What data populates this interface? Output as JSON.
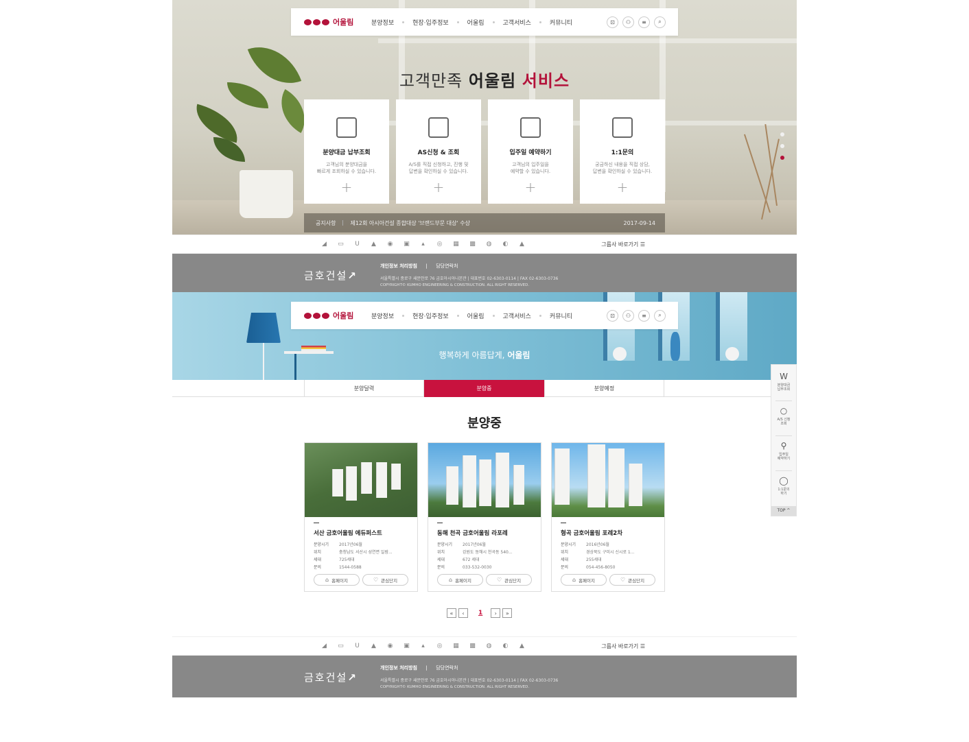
{
  "nav": {
    "logo_text": "어울림",
    "menu": [
      "분양정보",
      "현장·입주정보",
      "어울림",
      "고객서비스",
      "커뮤니티"
    ],
    "utils": [
      "lock-icon",
      "user-icon",
      "menu-icon",
      "search-icon"
    ]
  },
  "hero1": {
    "title_part1": "고객만족",
    "title_part2": "어울림",
    "title_part3": "서비스",
    "cards": [
      {
        "title": "분양대금 납부조회",
        "desc1": "고객님의 분양대금을",
        "desc2": "빠르게 조회하실 수 있습니다."
      },
      {
        "title": "AS신청 & 조회",
        "desc1": "A/S를 직접 신청하고, 진행 및",
        "desc2": "답변을 확인하실 수 있습니다."
      },
      {
        "title": "입주일 예약하기",
        "desc1": "고객님의 입주일을",
        "desc2": "예약할 수 있습니다."
      },
      {
        "title": "1:1문의",
        "desc1": "궁금하신 내용을 직접 상담,",
        "desc2": "답변을 확인하실 수 있습니다."
      }
    ],
    "plus": "+",
    "notice_label": "공지사항",
    "notice_text": "제12회 아시아건설 종합대상 '브랜드부문 대상' 수상",
    "notice_date": "2017-09-14"
  },
  "iconbar": {
    "icons": [
      "◢",
      "▭",
      "U",
      "▲",
      "◉",
      "▣",
      "▴",
      "◎",
      "▦",
      "▩",
      "◍",
      "◐",
      "▲"
    ],
    "shortcut": "그룹사 바로가기 ☰"
  },
  "footer": {
    "logo": "금호건설",
    "link1": "개인정보 처리방침",
    "sep": "|",
    "link2": "담당연락처",
    "address": "서울특별시 종로구 새문안로 76 금호아시아나본관  |  대표번호 02-6303-0114  |  FAX 02-6303-0736",
    "copyright": "COPYRIGHT© KUMHO ENGINEERING & CONSTRUCTION. ALL RIGHT RESERVED."
  },
  "hero2": {
    "title_part1": "행복하게 아름답게,",
    "title_part2": "어울림"
  },
  "tabs": [
    {
      "label": "분양달력",
      "active": false
    },
    {
      "label": "분양중",
      "active": true
    },
    {
      "label": "분양예정",
      "active": false
    }
  ],
  "section_title": "분양중",
  "projects": [
    {
      "name": "서산 금호어울림 에듀퍼스트",
      "rows": [
        {
          "k": "분양시기",
          "v": "2017년06월"
        },
        {
          "k": "위치",
          "v": "충청남도 서산시 성연면 일람..."
        },
        {
          "k": "세대",
          "v": "725세대"
        },
        {
          "k": "문의",
          "v": "1544-0588"
        }
      ],
      "btn_home": "홈페이지",
      "btn_fav": "관심단지"
    },
    {
      "name": "동해 천곡 금호어울림 라포레",
      "rows": [
        {
          "k": "분양시기",
          "v": "2017년06월"
        },
        {
          "k": "위치",
          "v": "강원도 동해시 천곡동 540..."
        },
        {
          "k": "세대",
          "v": "672 세대"
        },
        {
          "k": "문의",
          "v": "033-532-0030"
        }
      ],
      "btn_home": "홈페이지",
      "btn_fav": "관심단지"
    },
    {
      "name": "형곡 금호어울림 포레2차",
      "rows": [
        {
          "k": "분양시기",
          "v": "2016년06월"
        },
        {
          "k": "위치",
          "v": "경상북도 구미시 신시로 1..."
        },
        {
          "k": "세대",
          "v": "255세대"
        },
        {
          "k": "문의",
          "v": "054-456-8050"
        }
      ],
      "btn_home": "홈페이지",
      "btn_fav": "관심단지"
    }
  ],
  "pagination": {
    "first": "«",
    "prev": "‹",
    "current": "1",
    "next": "›",
    "last": "»"
  },
  "quick_menu": {
    "items": [
      {
        "icon": "W",
        "label1": "분양대금",
        "label2": "납부조회"
      },
      {
        "icon": "○",
        "label1": "A/S 신청",
        "label2": "조회"
      },
      {
        "icon": "⚲",
        "label1": "입주일",
        "label2": "예약하기"
      },
      {
        "icon": "◯",
        "label1": "1:1문의",
        "label2": "하기"
      }
    ],
    "top": "TOP ^"
  },
  "colors": {
    "brand_red": "#b3123a",
    "tab_active": "#c8123e",
    "footer_bg": "#888888"
  }
}
